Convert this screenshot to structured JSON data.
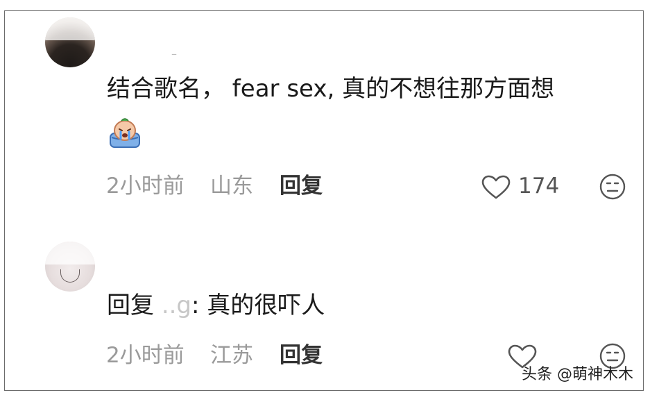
{
  "comments": [
    {
      "username": "–",
      "text": "结合歌名， fear sex, 真的不想往那方面想",
      "emoji": "crying-face-emoji",
      "time": "2小时前",
      "location": "山东",
      "reply_label": "回复",
      "likes": "174"
    },
    {
      "username": "",
      "reply_prefix": "回复",
      "mention": "..g",
      "separator": ":",
      "text": "真的很吓人",
      "time": "2小时前",
      "location": "江苏",
      "reply_label": "回复"
    }
  ],
  "watermark": "头条 @萌神木木",
  "icons": {
    "like": "heart-outline-icon",
    "dislike": "neutral-face-icon"
  },
  "colors": {
    "text": "#1a1a1a",
    "meta": "#9a9a9a",
    "border": "#6b6b6b"
  }
}
